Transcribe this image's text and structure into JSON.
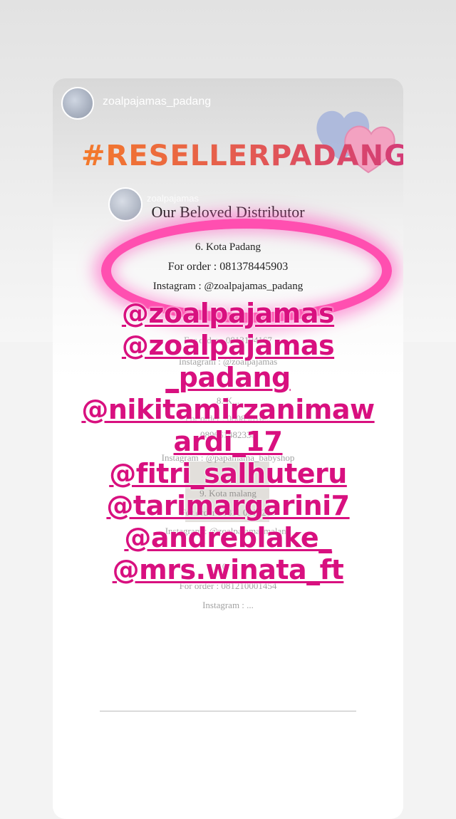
{
  "story": {
    "username": "zoalpajamas_padang",
    "hashtag": "#RESELLERPADANG"
  },
  "shared_post": {
    "username": "zoalpajamas",
    "title": "Our Beloved Distributor",
    "entry": {
      "city": "6. Kota Padang",
      "order": "For order : 081378445903",
      "instagram": "Instagram : @zoalpajamas_padang"
    },
    "ghost_lines": [
      "For order : 0813194167",
      "Instagram : @zoalpajamas",
      "8. K...",
      "For order : 08089810...",
      "089661482338",
      "Instagram : @papamama_babyshop",
      "9. Kota malang",
      "For order : 0811 0510203",
      "Instagram : @zoalpajamasmalang",
      "10. ...",
      "For order : 081210001454",
      "Instagram : ..."
    ]
  },
  "mentions": [
    "@zoalpajamas",
    "@zoalpajamas",
    "_padang",
    "@nikitamirzanimaw",
    "ardi_17",
    "@fitri_salhuteru",
    "@tarimargarini7",
    "@andreblake_",
    "@mrs.winata_ft"
  ],
  "colors": {
    "mention": "#d8107f",
    "highlight_circle": "#ff4fb0",
    "hashtag_start": "#f47a2a",
    "hashtag_end": "#d33b78",
    "heart_blue": "#a9b6dc",
    "heart_pink": "#f3a2c1"
  }
}
